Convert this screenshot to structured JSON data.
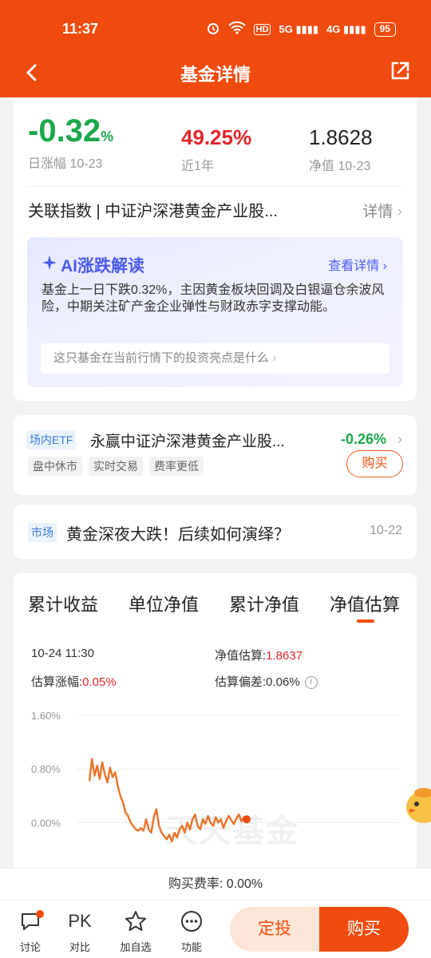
{
  "status_bar": {
    "time": "11:37",
    "network_hd": "HD",
    "network_5g": "5G",
    "network_4g": "4G",
    "battery": "95"
  },
  "nav": {
    "title": "基金详情"
  },
  "summary": {
    "daily_change": "-0.32",
    "daily_change_unit": "%",
    "daily_change_label": "日涨幅 10-23",
    "year_return": "49.25%",
    "year_return_label": "近1年",
    "nav_value": "1.8628",
    "nav_label": "净值 10-23"
  },
  "related_index": {
    "label": "关联指数 | 中证沪深港黄金产业股...",
    "more": "详情"
  },
  "ai_box": {
    "title": "AI涨跌解读",
    "more": "查看详情",
    "text": "基金上一日下跌0.32%，主因黄金板块回调及白银逼仓余波风险，中期关注矿产金企业弹性与财政赤字支撑动能。",
    "question": "这只基金在当前行情下的投资亮点是什么"
  },
  "etf": {
    "tag": "场内ETF",
    "name": "永赢中证沪深港黄金产业股...",
    "change": "-0.26%",
    "chips": [
      "盘中休市",
      "实时交易",
      "费率更低"
    ],
    "buy": "购买"
  },
  "market_news": {
    "tag": "市场",
    "title": "黄金深夜大跌！后续如何演绎？",
    "date": "10-22"
  },
  "chart_section": {
    "tabs": [
      "累计收益",
      "单位净值",
      "累计净值",
      "净值估算"
    ],
    "active_tab": 3,
    "time": "10-24 11:30",
    "est_nav_label": "净值估算:",
    "est_nav_value": "1.8637",
    "est_change_label": "估算涨幅:",
    "est_change_value": "0.05%",
    "est_dev_label": "估算偏差:",
    "est_dev_value": "0.06%",
    "watermark": "天天基金"
  },
  "chart_data": {
    "type": "line",
    "title": "",
    "xlabel": "",
    "ylabel": "",
    "yticks": [
      "1.60%",
      "0.80%",
      "0.00%"
    ],
    "ylim": [
      -0.4,
      1.6
    ],
    "series": [
      {
        "color": "#e8742a",
        "values": [
          0.62,
          0.95,
          0.7,
          0.85,
          0.65,
          0.9,
          0.72,
          0.6,
          0.82,
          0.68,
          0.75,
          0.55,
          0.4,
          0.3,
          0.15,
          0.1,
          0.0,
          -0.05,
          -0.1,
          -0.12,
          -0.08,
          -0.12,
          0.05,
          -0.1,
          -0.15,
          0.08,
          0.2,
          -0.05,
          -0.15,
          -0.2,
          -0.25,
          -0.18,
          -0.28,
          -0.15,
          -0.22,
          -0.1,
          -0.05,
          -0.15,
          0.0,
          -0.1,
          0.05,
          0.12,
          -0.05,
          -0.1,
          0.05,
          -0.02,
          0.1,
          0.0,
          -0.05,
          0.08,
          0.0,
          0.05,
          -0.08,
          0.02,
          0.1,
          0.04,
          -0.02,
          0.06,
          0.12,
          0.02,
          0.08,
          0.05
        ]
      }
    ]
  },
  "fee": {
    "label": "购买费率: 0.00%"
  },
  "bottom_bar": {
    "items": [
      {
        "icon": "comment-icon",
        "label": "讨论"
      },
      {
        "icon": "pk-icon",
        "label": "对比",
        "icon_text": "PK"
      },
      {
        "icon": "star-icon",
        "label": "加自选"
      },
      {
        "icon": "more-dots-icon",
        "label": "功能"
      }
    ],
    "dingtou": "定投",
    "buy": "购买"
  },
  "colors": {
    "brand": "#f04b0e",
    "down": "#1aa84b",
    "up": "#e0262b",
    "ai": "#4b5bf0"
  }
}
